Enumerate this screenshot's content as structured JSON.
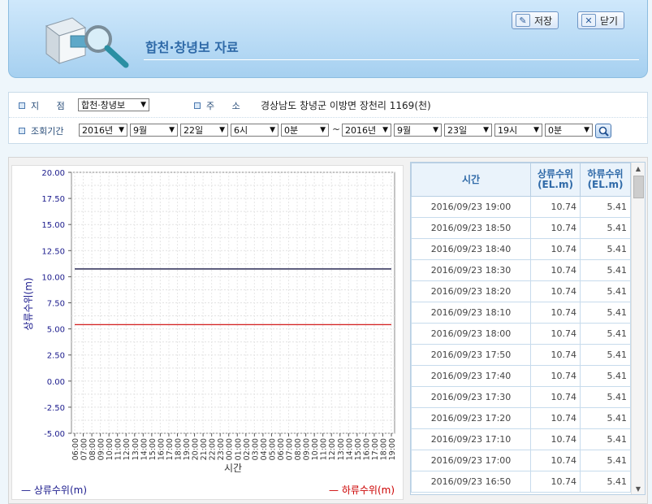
{
  "header": {
    "title": "합천·창녕보 자료",
    "save_label": "저장",
    "close_label": "닫기"
  },
  "form": {
    "site_label": "지  점",
    "site_value": "합천·창녕보",
    "address_label": "주  소",
    "address_value": "경상남도 창녕군 이방면 장천리 1169(천)",
    "period_label": "조회기간",
    "start": {
      "year": "2016년",
      "month": "9월",
      "day": "22일",
      "hour": "6시",
      "minute": "0분"
    },
    "separator": "~",
    "end": {
      "year": "2016년",
      "month": "9월",
      "day": "23일",
      "hour": "19시",
      "minute": "0분"
    }
  },
  "chart_data": {
    "type": "line",
    "xlabel": "시간",
    "ylabel": "상류수위(m)",
    "ylim": [
      -5,
      20
    ],
    "yticks": [
      "20.00",
      "17.50",
      "15.00",
      "12.50",
      "10.00",
      "7.50",
      "5.00",
      "2.50",
      "0.00",
      "-2.50",
      "-5.00"
    ],
    "categories": [
      "06:00",
      "07:00",
      "08:00",
      "09:00",
      "10:00",
      "11:00",
      "12:00",
      "13:00",
      "14:00",
      "15:00",
      "16:00",
      "17:00",
      "18:00",
      "19:00",
      "20:00",
      "21:00",
      "22:00",
      "23:00",
      "00:00",
      "01:00",
      "02:00",
      "03:00",
      "04:00",
      "05:00",
      "06:00",
      "07:00",
      "08:00",
      "09:00",
      "10:00",
      "11:00",
      "12:00",
      "13:00",
      "14:00",
      "15:00",
      "16:00",
      "17:00",
      "18:00",
      "19:00"
    ],
    "series": [
      {
        "name": "상류수위(m)",
        "color": "#000033",
        "value": 10.74
      },
      {
        "name": "하류수위(m)",
        "color": "#cc0000",
        "value": 5.41
      }
    ],
    "legend_left": "— 상류수위(m)",
    "legend_right": "— 하류수위(m)"
  },
  "table": {
    "col_time": "시간",
    "col_up": "상류수위 (EL.m)",
    "col_down": "하류수위 (EL.m)",
    "rows": [
      [
        "2016/09/23 19:00",
        "10.74",
        "5.41"
      ],
      [
        "2016/09/23 18:50",
        "10.74",
        "5.41"
      ],
      [
        "2016/09/23 18:40",
        "10.74",
        "5.41"
      ],
      [
        "2016/09/23 18:30",
        "10.74",
        "5.41"
      ],
      [
        "2016/09/23 18:20",
        "10.74",
        "5.41"
      ],
      [
        "2016/09/23 18:10",
        "10.74",
        "5.41"
      ],
      [
        "2016/09/23 18:00",
        "10.74",
        "5.41"
      ],
      [
        "2016/09/23 17:50",
        "10.74",
        "5.41"
      ],
      [
        "2016/09/23 17:40",
        "10.74",
        "5.41"
      ],
      [
        "2016/09/23 17:30",
        "10.74",
        "5.41"
      ],
      [
        "2016/09/23 17:20",
        "10.74",
        "5.41"
      ],
      [
        "2016/09/23 17:10",
        "10.74",
        "5.41"
      ],
      [
        "2016/09/23 17:00",
        "10.74",
        "5.41"
      ],
      [
        "2016/09/23 16:50",
        "10.74",
        "5.41"
      ]
    ]
  },
  "icons": {
    "logo": "magnifier-document-icon",
    "save": "save-icon",
    "close": "close-icon",
    "search": "search-icon"
  }
}
